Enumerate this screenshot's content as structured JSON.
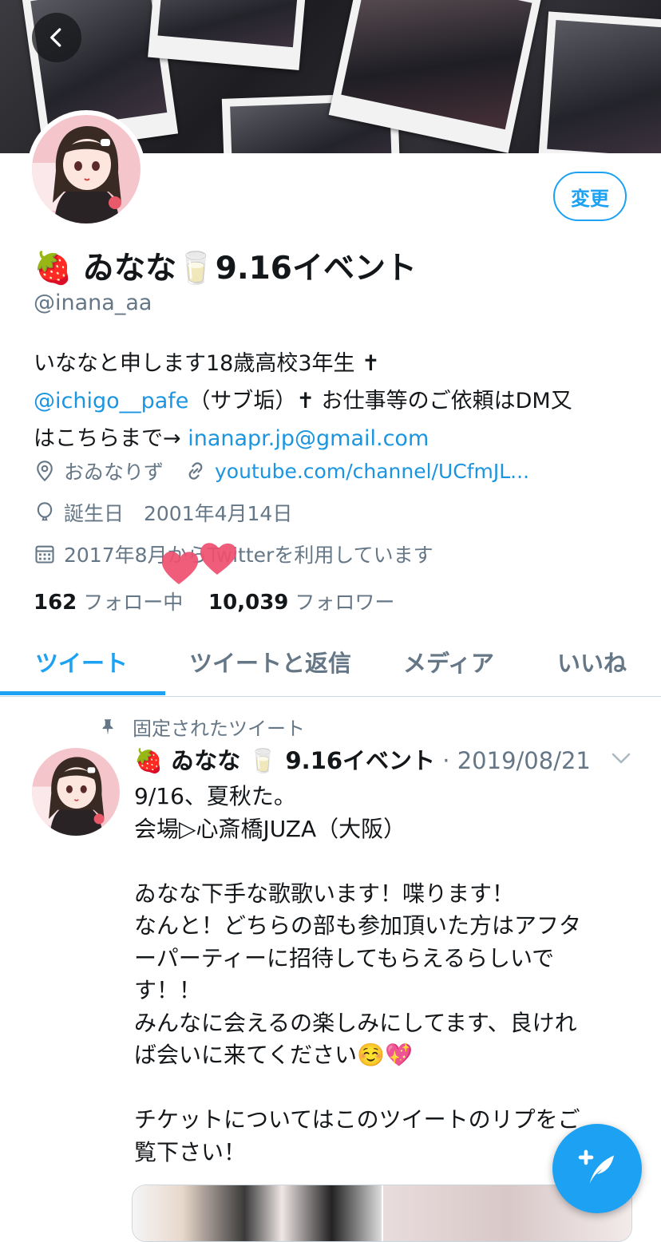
{
  "profile": {
    "name_emoji_1": "🍓",
    "name": "ゐなな",
    "name_emoji_2": "🥛",
    "name_suffix": "9.16イベント",
    "handle": "@inana_aa",
    "edit_label": "変更",
    "bio": {
      "line1": "いななと申します18歳高校3年生 ✝",
      "mention": "@ichigo__pafe",
      "line2_rest": "（サブ垢）✝ お仕事等のご依頼はDM又",
      "line3_prefix": "はこちらまで→ ",
      "email": "inanapr.jp@gmail.com"
    },
    "location": "おゐなりず",
    "website": "youtube.com/channel/UCfmJL...",
    "birthday": "誕生日　2001年4月14日",
    "joined": "2017年8月からTwitterを利用しています",
    "following_count": "162",
    "following_label": "フォロー中",
    "followers_count": "10,039",
    "followers_label": "フォロワー"
  },
  "tabs": [
    "ツイート",
    "ツイートと返信",
    "メディア",
    "いいね"
  ],
  "pinned_tweet": {
    "pinned_label": "固定されたツイート",
    "author_name": "🍓 ゐなな 🥛 9.16イベント",
    "separator": " · ",
    "date": "2019/08/21",
    "lines": [
      "9/16、夏秋た。",
      "会場▷心斎橋JUZA（大阪）",
      "",
      "ゐなな下手な歌歌います！喋ります！",
      "なんと！どちらの部も参加頂いた方はアフタ",
      "ーパーティーに招待してもらえるらしいで",
      "す！！",
      "みんなに会えるの楽しみにしてます、良けれ",
      "ば会いに来てください☺️💖",
      "",
      "チケットについてはこのツイートのリプをご",
      "覧下さい！"
    ]
  },
  "colors": {
    "accent": "#1da1f2",
    "link": "#1b95e0",
    "secondary_text": "#657786"
  },
  "icons": [
    "back-arrow-icon",
    "location-icon",
    "link-icon",
    "balloon-icon",
    "calendar-icon",
    "pin-icon",
    "chevron-down-icon",
    "compose-icon"
  ]
}
